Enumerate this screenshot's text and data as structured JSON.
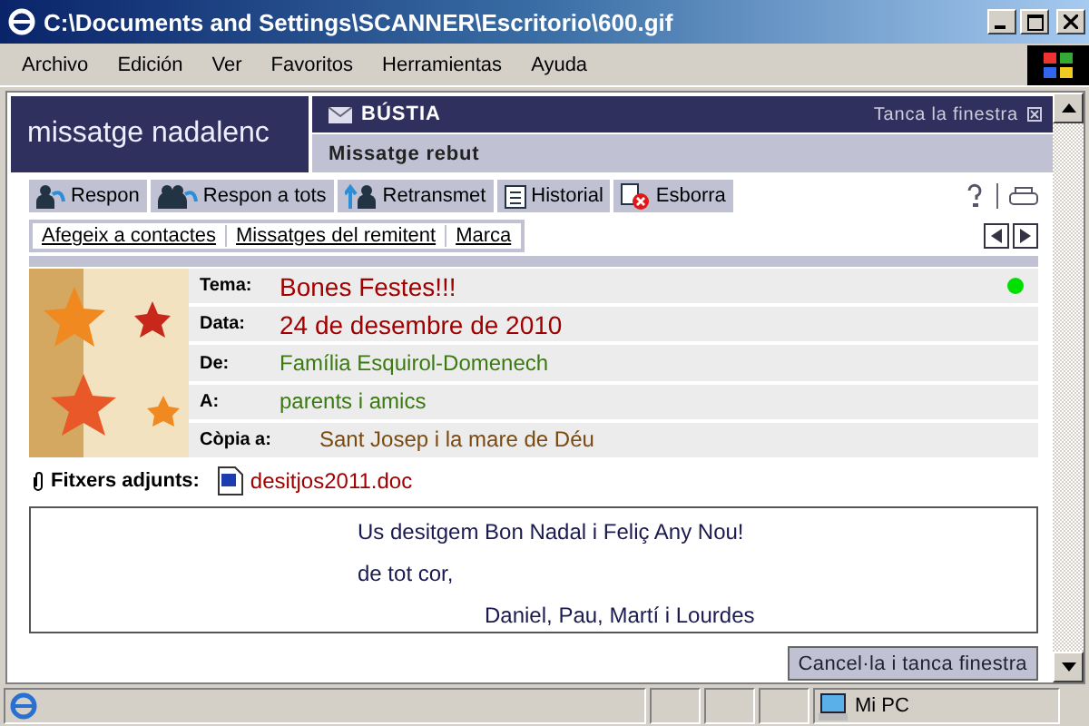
{
  "window": {
    "title": "C:\\Documents and Settings\\SCANNER\\Escritorio\\600.gif"
  },
  "menu": [
    "Archivo",
    "Edición",
    "Ver",
    "Favoritos",
    "Herramientas",
    "Ayuda"
  ],
  "header": {
    "brand": "missatge nadalenc",
    "section": "BÚSTIA",
    "close_link": "Tanca la finestra",
    "subtitle": "Missatge rebut"
  },
  "toolbar": [
    {
      "label": "Respon",
      "kind": "reply"
    },
    {
      "label": "Respon a tots",
      "kind": "replyall"
    },
    {
      "label": "Retransmet",
      "kind": "forward"
    },
    {
      "label": "Historial",
      "kind": "history"
    },
    {
      "label": "Esborra",
      "kind": "delete"
    }
  ],
  "links": [
    "Afegeix a contactes",
    "Missatges del remitent",
    "Marca"
  ],
  "fields": [
    {
      "label": "Tema:",
      "value": "Bones Festes!!!",
      "color": "#a00000",
      "dot": true
    },
    {
      "label": "Data:",
      "value": "24 de desembre de 2010",
      "color": "#a00000",
      "dot": false
    },
    {
      "label": "De:",
      "value": "Família Esquirol-Domenech",
      "color": "#3a7a10",
      "dot": false
    },
    {
      "label": "A:",
      "value": "parents i amics",
      "color": "#3a7a10",
      "dot": false
    },
    {
      "label": "Còpia a:",
      "value": "Sant Josep i la mare de Déu",
      "color": "#7a4a10",
      "dot": false
    }
  ],
  "attachments": {
    "label": "Fitxers adjunts:",
    "files": [
      "desitjos2011.doc"
    ]
  },
  "body": [
    "Us desitgem Bon Nadal i Feliç Any Nou!",
    "de tot cor,",
    "Daniel, Pau, Martí i Lourdes"
  ],
  "cancel_button": "Cancel·la i tanca finestra",
  "status_bar": {
    "zone": "Mi PC"
  }
}
